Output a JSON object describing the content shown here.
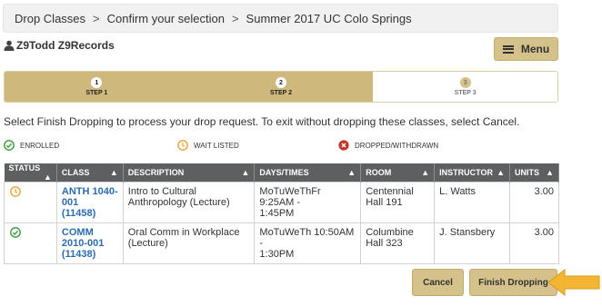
{
  "breadcrumb": {
    "items": [
      "Drop Classes",
      "Confirm your selection",
      "Summer 2017 UC Colo Springs"
    ],
    "separator": ">"
  },
  "user": {
    "name": "Z9Todd Z9Records",
    "icon": "person-icon"
  },
  "menu": {
    "label": "Menu",
    "icon": "hamburger-icon"
  },
  "steps": [
    {
      "number": "1",
      "label": "STEP 1",
      "state": "complete"
    },
    {
      "number": "2",
      "label": "STEP 2",
      "state": "complete"
    },
    {
      "number": "3",
      "label": "STEP 3",
      "state": "incomplete"
    }
  ],
  "instructions": "Select Finish Dropping to process your drop request. To exit without dropping these classes, select Cancel.",
  "legend": {
    "enrolled": "ENROLLED",
    "waitlisted": "WAIT LISTED",
    "dropped": "DROPPED/WITHDRAWN"
  },
  "table": {
    "headers": [
      "STATUS",
      "CLASS",
      "DESCRIPTION",
      "DAYS/TIMES",
      "ROOM",
      "INSTRUCTOR",
      "UNITS"
    ],
    "rows": [
      {
        "status": "waitlisted",
        "class": "ANTH 1040-001 (11458)",
        "class_lines": [
          "ANTH 1040-",
          "001",
          "(11458)"
        ],
        "description_lines": [
          "Intro to Cultural",
          "Anthropology (Lecture)"
        ],
        "days_lines": [
          "MoTuWeThFr 9:25AM -",
          "1:45PM"
        ],
        "room_lines": [
          "Centennial",
          "Hall 191"
        ],
        "instructor": "L. Watts",
        "units": "3.00"
      },
      {
        "status": "enrolled",
        "class": "COMM 2010-001 (11438)",
        "class_lines": [
          "COMM",
          "2010-001",
          "(11438)"
        ],
        "description_lines": [
          "Oral Comm in Workplace",
          "(Lecture)"
        ],
        "days_lines": [
          "MoTuWeTh 10:50AM -",
          "1:30PM"
        ],
        "room_lines": [
          "Columbine",
          "Hall 323"
        ],
        "instructor": "J. Stansbery",
        "units": "3.00"
      }
    ]
  },
  "buttons": {
    "cancel": "Cancel",
    "finish": "Finish Dropping"
  },
  "colors": {
    "gold": "#cfb87c",
    "header_gray": "#5d5f61",
    "enrolled_green": "#3a9a3a",
    "waitlist_orange": "#e8a33a",
    "dropped_red": "#c0392b",
    "arrow_yellow": "#f2b632"
  }
}
